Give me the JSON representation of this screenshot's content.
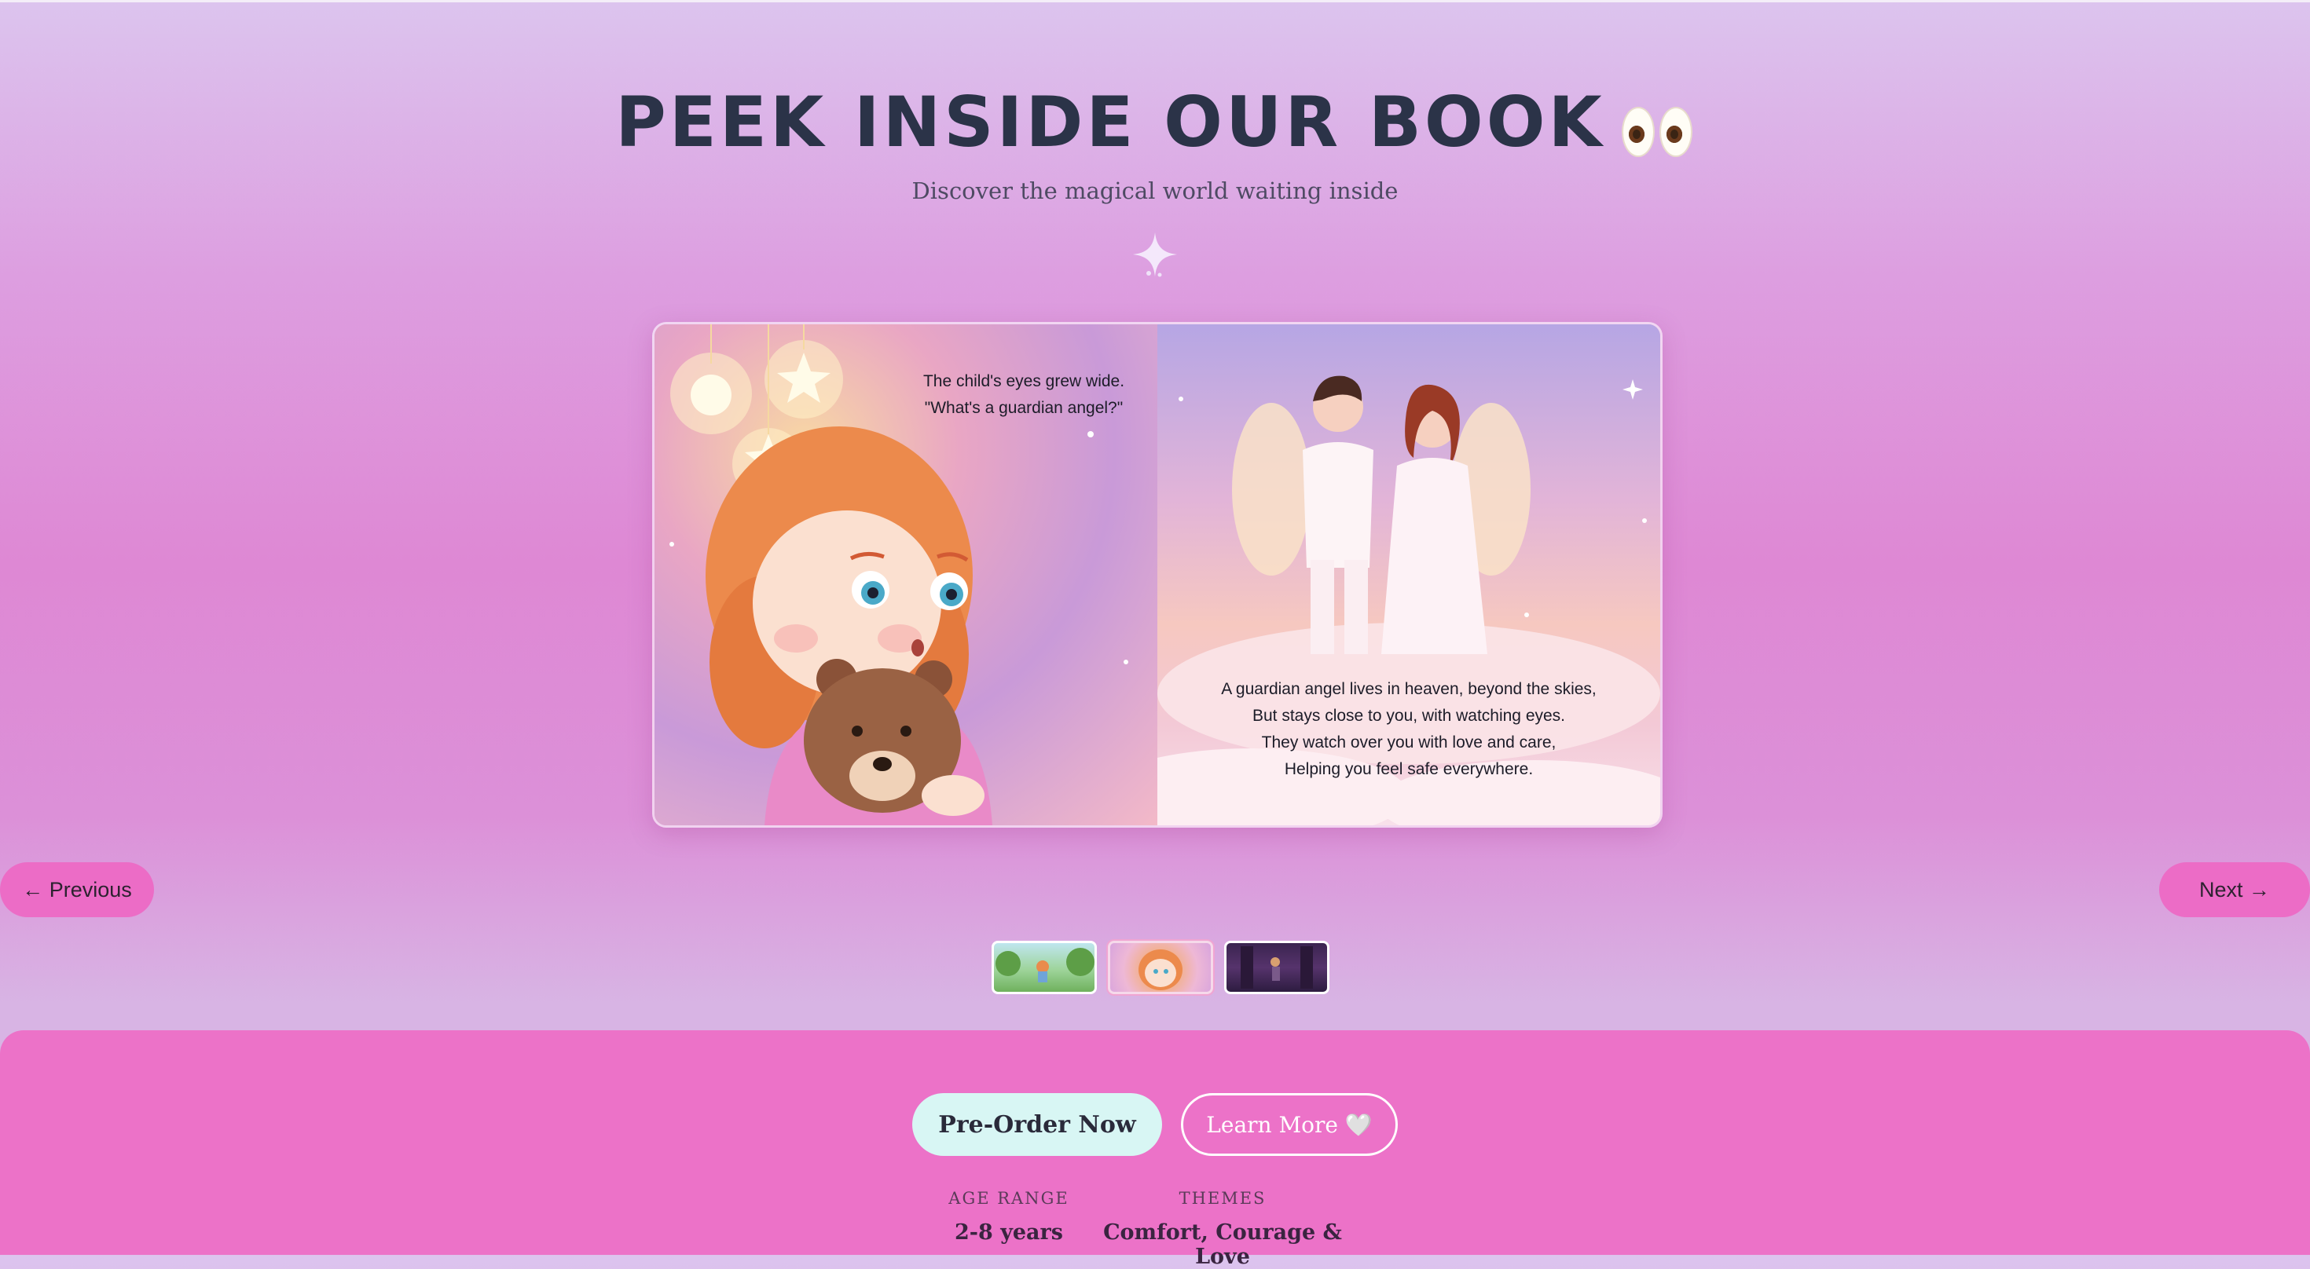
{
  "header": {
    "title": "PEEK INSIDE OUR BOOK",
    "title_emoji": "eyes-icon",
    "subtitle": "Discover the magical world waiting inside",
    "divider_icon": "sparkle-icon"
  },
  "book": {
    "left_page_text": [
      "The child's eyes grew wide.",
      "\"What's a guardian angel?\""
    ],
    "right_page_text": [
      "A guardian angel lives in heaven, beyond the skies,",
      "But stays close to you, with watching eyes.",
      "They watch over you with love and care,",
      "Helping you feel safe everywhere."
    ]
  },
  "navigation": {
    "previous_label": "← Previous",
    "next_label": "Next →"
  },
  "thumbnails": {
    "count": 3,
    "active_index": 1
  },
  "cta": {
    "preorder_label": "Pre-Order Now",
    "learn_more_label": "Learn More 🤍"
  },
  "info": {
    "age_range_label": "AGE RANGE",
    "age_range_value": "2-8 years",
    "themes_label": "THEMES",
    "themes_value": "Comfort, Courage & Love"
  },
  "colors": {
    "accent_pink": "#ec72c8",
    "title_dark": "#2b3348",
    "button_mint": "#d8f6f4"
  }
}
